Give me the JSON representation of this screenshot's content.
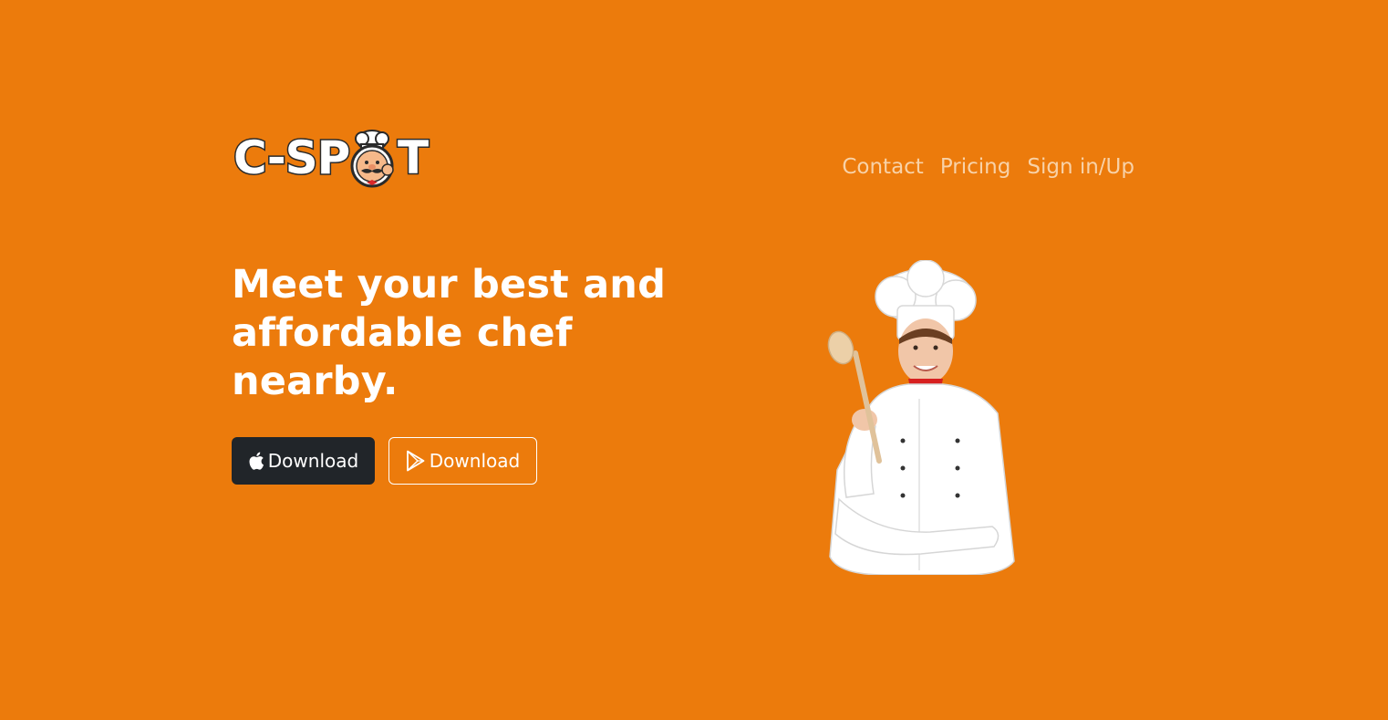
{
  "brand": {
    "logo_text_part1": "C-SP",
    "logo_text_part2": "T"
  },
  "nav": {
    "items": [
      {
        "label": "Contact"
      },
      {
        "label": "Pricing"
      },
      {
        "label": "Sign in/Up"
      }
    ]
  },
  "hero": {
    "title": "Meet your best and affordable chef nearby.",
    "buttons": [
      {
        "label": "Download",
        "icon": "apple-icon"
      },
      {
        "label": "Download",
        "icon": "play-store-icon"
      }
    ]
  },
  "colors": {
    "background": "#ec7b0c",
    "nav_link": "#f8d2a8",
    "dark_button": "#212529",
    "white": "#ffffff"
  }
}
